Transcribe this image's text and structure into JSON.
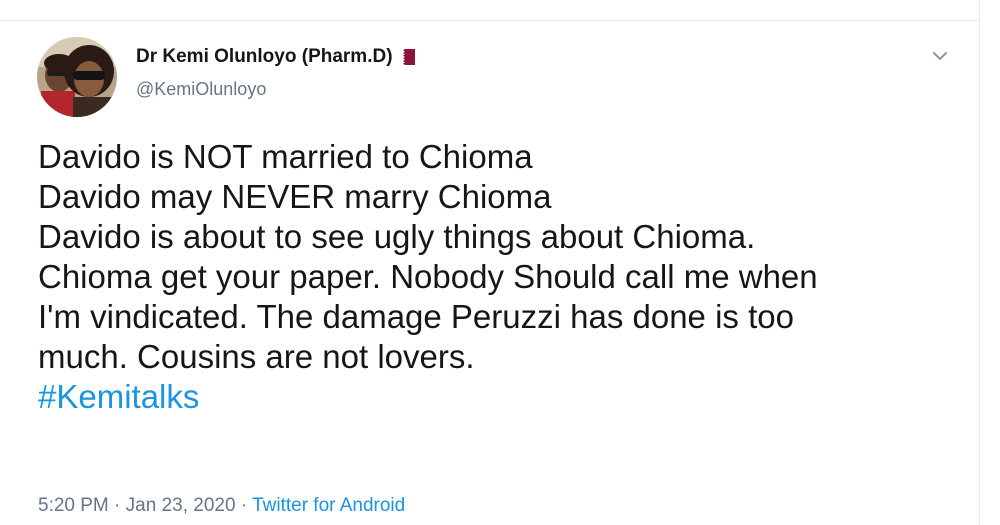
{
  "tweet": {
    "display_name": "Dr Kemi Olunloyo (Pharm.D)",
    "handle": "@KemiOlunloyo",
    "badge_icon": "qatar-flag-icon",
    "menu_icon": "chevron-down-icon",
    "lines": [
      "Davido is NOT married to Chioma",
      "Davido may NEVER marry Chioma",
      "Davido is about to see ugly things about Chioma.",
      "Chioma get your paper. Nobody Should call me when",
      "I'm vindicated. The damage Peruzzi has done is too",
      "much. Cousins are not lovers."
    ],
    "hashtag": "#Kemitalks",
    "time": "5:20 PM",
    "separator": " · ",
    "date": "Jan 23, 2020",
    "source": "Twitter for Android"
  },
  "colors": {
    "text": "#14171a",
    "muted": "#657786",
    "link": "#1b95e0",
    "flag": "#8a1538"
  }
}
